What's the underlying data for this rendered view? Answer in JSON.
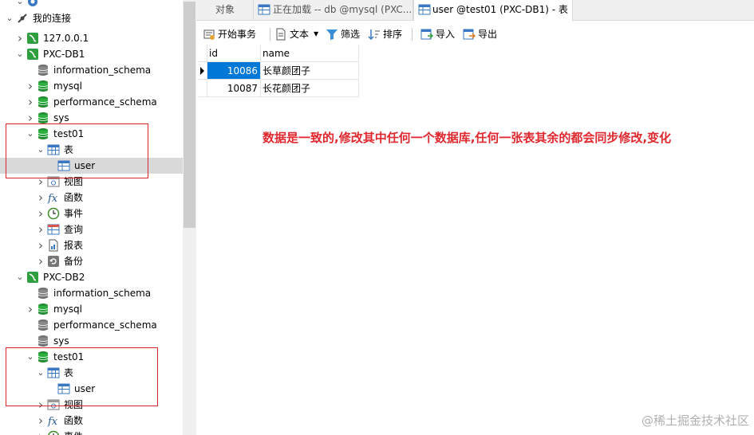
{
  "sidebar": {
    "rows": [
      {
        "label": "",
        "icon": "event-icon",
        "indent": 1,
        "expander": "down"
      },
      {
        "label": "我的连接",
        "icon": "connection-icon",
        "indent": 0,
        "expander": "down"
      },
      {
        "label": "127.0.0.1",
        "icon": "server-icon",
        "indent": 1,
        "expander": "right"
      },
      {
        "label": "PXC-DB1",
        "icon": "server-icon",
        "indent": 1,
        "expander": "down"
      },
      {
        "label": "information_schema",
        "icon": "database-gray-icon",
        "indent": 2,
        "expander": ""
      },
      {
        "label": "mysql",
        "icon": "database-green-icon",
        "indent": 2,
        "expander": "right"
      },
      {
        "label": "performance_schema",
        "icon": "database-green-icon",
        "indent": 2,
        "expander": "right"
      },
      {
        "label": "sys",
        "icon": "database-green-icon",
        "indent": 2,
        "expander": "right"
      },
      {
        "label": "test01",
        "icon": "database-green-icon",
        "indent": 2,
        "expander": "down"
      },
      {
        "label": "表",
        "icon": "table-folder-icon",
        "indent": 3,
        "expander": "down"
      },
      {
        "label": "user",
        "icon": "table-icon",
        "indent": 4,
        "expander": "",
        "selected": true
      },
      {
        "label": "视图",
        "icon": "view-icon",
        "indent": 3,
        "expander": "right"
      },
      {
        "label": "函数",
        "icon": "function-icon",
        "indent": 3,
        "expander": "right"
      },
      {
        "label": "事件",
        "icon": "clock-icon",
        "indent": 3,
        "expander": "right"
      },
      {
        "label": "查询",
        "icon": "query-icon",
        "indent": 3,
        "expander": "right"
      },
      {
        "label": "报表",
        "icon": "report-icon",
        "indent": 3,
        "expander": "right"
      },
      {
        "label": "备份",
        "icon": "backup-icon",
        "indent": 3,
        "expander": "right"
      },
      {
        "label": "PXC-DB2",
        "icon": "server-icon",
        "indent": 1,
        "expander": "down"
      },
      {
        "label": "information_schema",
        "icon": "database-gray-icon",
        "indent": 2,
        "expander": ""
      },
      {
        "label": "mysql",
        "icon": "database-green-icon",
        "indent": 2,
        "expander": "right"
      },
      {
        "label": "performance_schema",
        "icon": "database-gray-icon",
        "indent": 2,
        "expander": ""
      },
      {
        "label": "sys",
        "icon": "database-gray-icon",
        "indent": 2,
        "expander": ""
      },
      {
        "label": "test01",
        "icon": "database-green-icon",
        "indent": 2,
        "expander": "down"
      },
      {
        "label": "表",
        "icon": "table-folder-icon",
        "indent": 3,
        "expander": "down"
      },
      {
        "label": "user",
        "icon": "table-icon",
        "indent": 4,
        "expander": ""
      },
      {
        "label": "视图",
        "icon": "view-icon",
        "indent": 3,
        "expander": "right"
      },
      {
        "label": "函数",
        "icon": "function-icon",
        "indent": 3,
        "expander": "right"
      },
      {
        "label": "事件",
        "icon": "clock-icon",
        "indent": 3,
        "expander": "right"
      }
    ]
  },
  "tabs": [
    {
      "label": "对象",
      "icon": ""
    },
    {
      "label": "正在加载 -- db @mysql (PXC...",
      "icon": "table-icon"
    },
    {
      "label": "user @test01 (PXC-DB1) - 表",
      "icon": "table-icon",
      "active": true
    }
  ],
  "toolbar": {
    "begin_transaction": "开始事务",
    "text": "文本",
    "filter": "筛选",
    "sort": "排序",
    "import": "导入",
    "export": "导出"
  },
  "grid": {
    "columns": [
      "id",
      "name"
    ],
    "rows": [
      [
        "10086",
        "长草颜团子"
      ],
      [
        "10087",
        "长花颜团子"
      ]
    ]
  },
  "annotation": "数据是一致的,修改其中任何一个数据库,任何一张表其余的都会同步修改,变化",
  "watermark": "@稀土掘金技术社区",
  "colors": {
    "annotation": "#e0282e",
    "highlight_box": "#d9262c",
    "selected_cell": "#0078d7"
  }
}
